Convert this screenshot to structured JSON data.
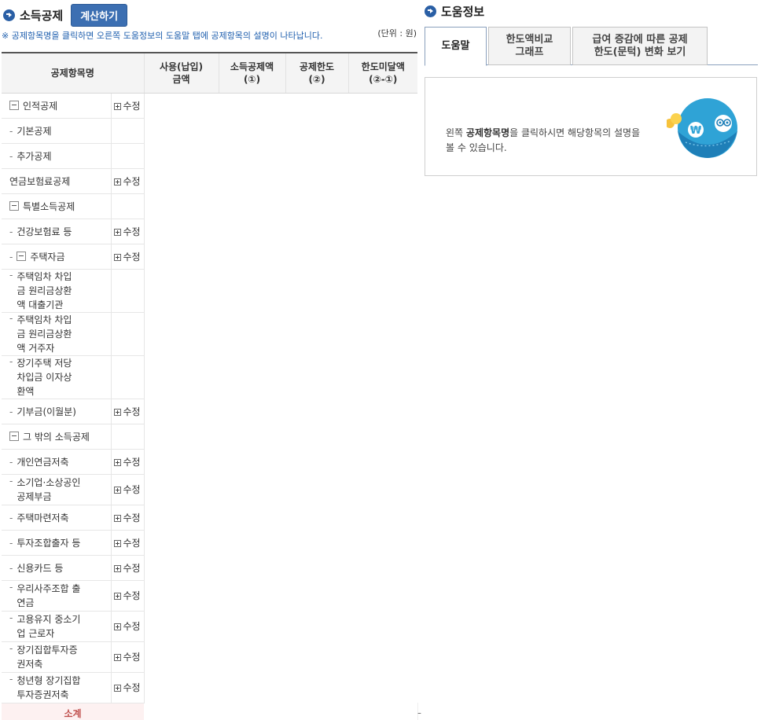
{
  "left": {
    "title": "소득공제",
    "calc_button": "계산하기",
    "notice": "※ 공제항목명을 클릭하면 오른쪽 도움정보의 도움말 탭에 공제항목의 설명이 나타납니다.",
    "unit": "(단위 : 원)",
    "headers": {
      "name": "공제항목명",
      "used_1": "사용(납입)",
      "used_2": "금액",
      "deduct_1": "소득공제액",
      "deduct_2": "(①)",
      "limit_1": "공제한도",
      "limit_2": "(②)",
      "remain_1": "한도미달액",
      "remain_2": "(②-①)"
    },
    "edit_label": "수정",
    "rows": {
      "r1": "인적공제",
      "r2": "기본공제",
      "r3": "추가공제",
      "r4": "연금보험료공제",
      "r5": "특별소득공제",
      "r6": "건강보험료 등",
      "r7": "주택자금",
      "r8": "주택임차 차입금 원리금상환액 대출기관",
      "r9": "주택임차 차입금 원리금상환액 거주자",
      "r10": "장기주택 저당차입금 이자상환액",
      "r11": "기부금(이월분)",
      "r12": "그 밖의 소득공제",
      "r13": "개인연금저축",
      "r14": "소기업·소상공인 공제부금",
      "r15": "주택마련저축",
      "r16": "투자조합출자 등",
      "r17": "신용카드 등",
      "r18": "우리사주조합 출연금",
      "r19": "고용유지 중소기업 근로자",
      "r20": "장기집합투자증권저축",
      "r21": "청년형 장기집합투자증권저축"
    },
    "summary": {
      "label": "소계",
      "used": "-",
      "limit": "-",
      "remain": "-"
    }
  },
  "right": {
    "title": "도움정보",
    "tabs": {
      "help": "도움말",
      "graph_1": "한도액비교",
      "graph_2": "그래프",
      "change_1": "급여 증감에 따른 공제",
      "change_2": "한도(문턱) 변화 보기"
    },
    "help_pre": "왼쪽 ",
    "help_bold": "공제항목명",
    "help_post": "을 클릭하시면 해당항목의 설명을 볼 수 있습니다.",
    "illustration_icon": "won-coin-character-icon"
  }
}
